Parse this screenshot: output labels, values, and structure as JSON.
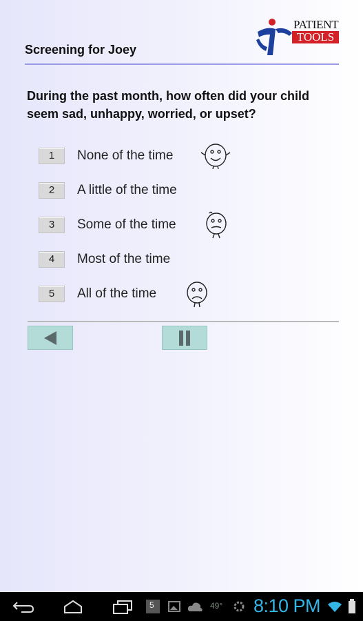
{
  "header": {
    "title": "Screening for Joey",
    "logo_line1": "PATIENT",
    "logo_line2": "TOOLS"
  },
  "question": "During the past month, how often did your child seem sad, unhappy, worried, or upset?",
  "options": [
    {
      "number": "1",
      "label": "None of the time"
    },
    {
      "number": "2",
      "label": "A little of the time"
    },
    {
      "number": "3",
      "label": "Some of the time"
    },
    {
      "number": "4",
      "label": "Most of the time"
    },
    {
      "number": "5",
      "label": "All of the time"
    }
  ],
  "nav": {
    "back_icon": "triangle-left-icon",
    "pause_icon": "pause-icon"
  },
  "status": {
    "time": "8:10 PM",
    "temperature": "49°",
    "notification_count": "5"
  },
  "colors": {
    "accent_rule": "#9a9ae6",
    "nav_button": "#b3dcd8",
    "clock": "#33b5e5",
    "logo_red": "#d42027"
  }
}
